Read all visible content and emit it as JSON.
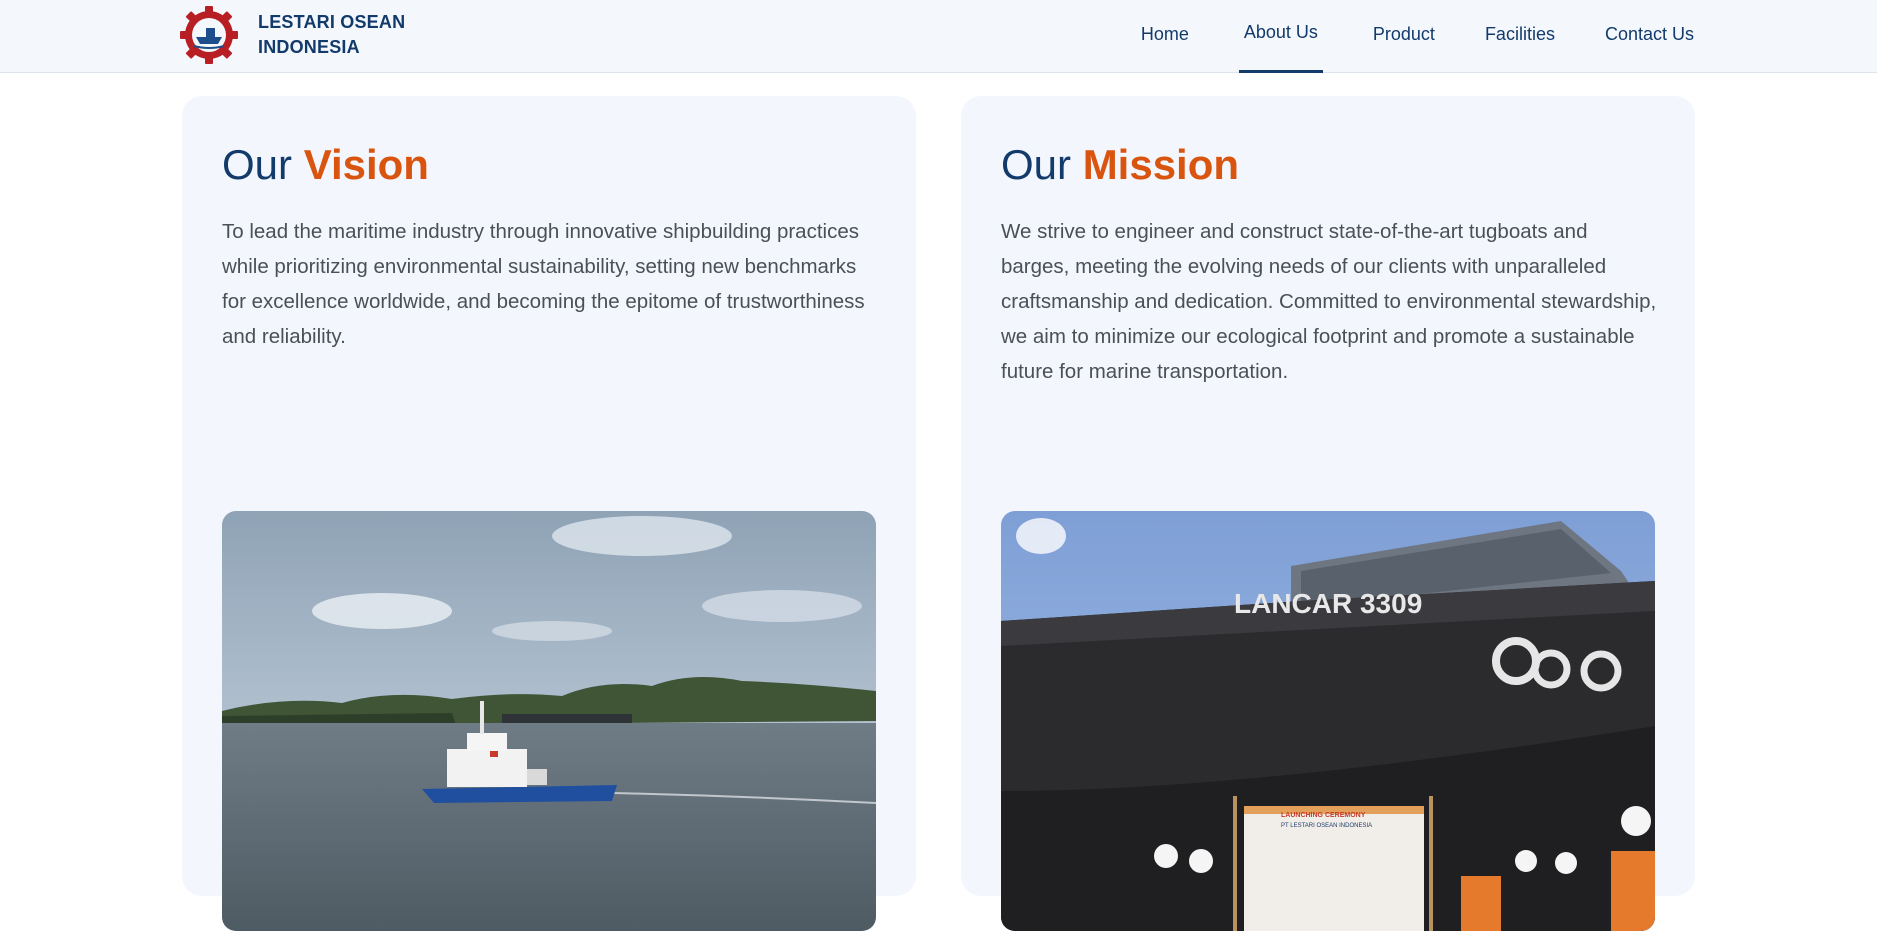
{
  "brand": {
    "name_line1": "LESTARI OSEAN",
    "name_line2": "INDONESIA"
  },
  "nav": {
    "items": [
      {
        "label": "Home",
        "active": false
      },
      {
        "label": "About Us",
        "active": true
      },
      {
        "label": "Product",
        "active": false
      },
      {
        "label": "Facilities",
        "active": false
      },
      {
        "label": "Contact Us",
        "active": false
      }
    ]
  },
  "vision": {
    "title_prefix": "Our",
    "title_accent": "Vision",
    "text": "To lead the maritime industry through innovative shipbuilding practices while prioritizing environmental sustainability, setting new benchmarks for excellence worldwide, and becoming the epitome of trustworthiness and reliability."
  },
  "mission": {
    "title_prefix": "Our",
    "title_accent": "Mission",
    "text": "We strive to engineer and construct state-of-the-art tugboats and barges, meeting the evolving needs of our clients with unparalleled craftsmanship and dedication. Committed to environmental stewardship, we aim to minimize our ecological footprint and promote a sustainable future for marine transportation.",
    "photo_hull_text": "LANCAR 3309",
    "banner_title": "LAUNCHING CEREMONY",
    "banner_company": "PT LESTARI OSEAN INDONESIA"
  },
  "colors": {
    "primary": "#123a6b",
    "accent": "#d9540f",
    "card_bg": "#f3f7fd"
  }
}
